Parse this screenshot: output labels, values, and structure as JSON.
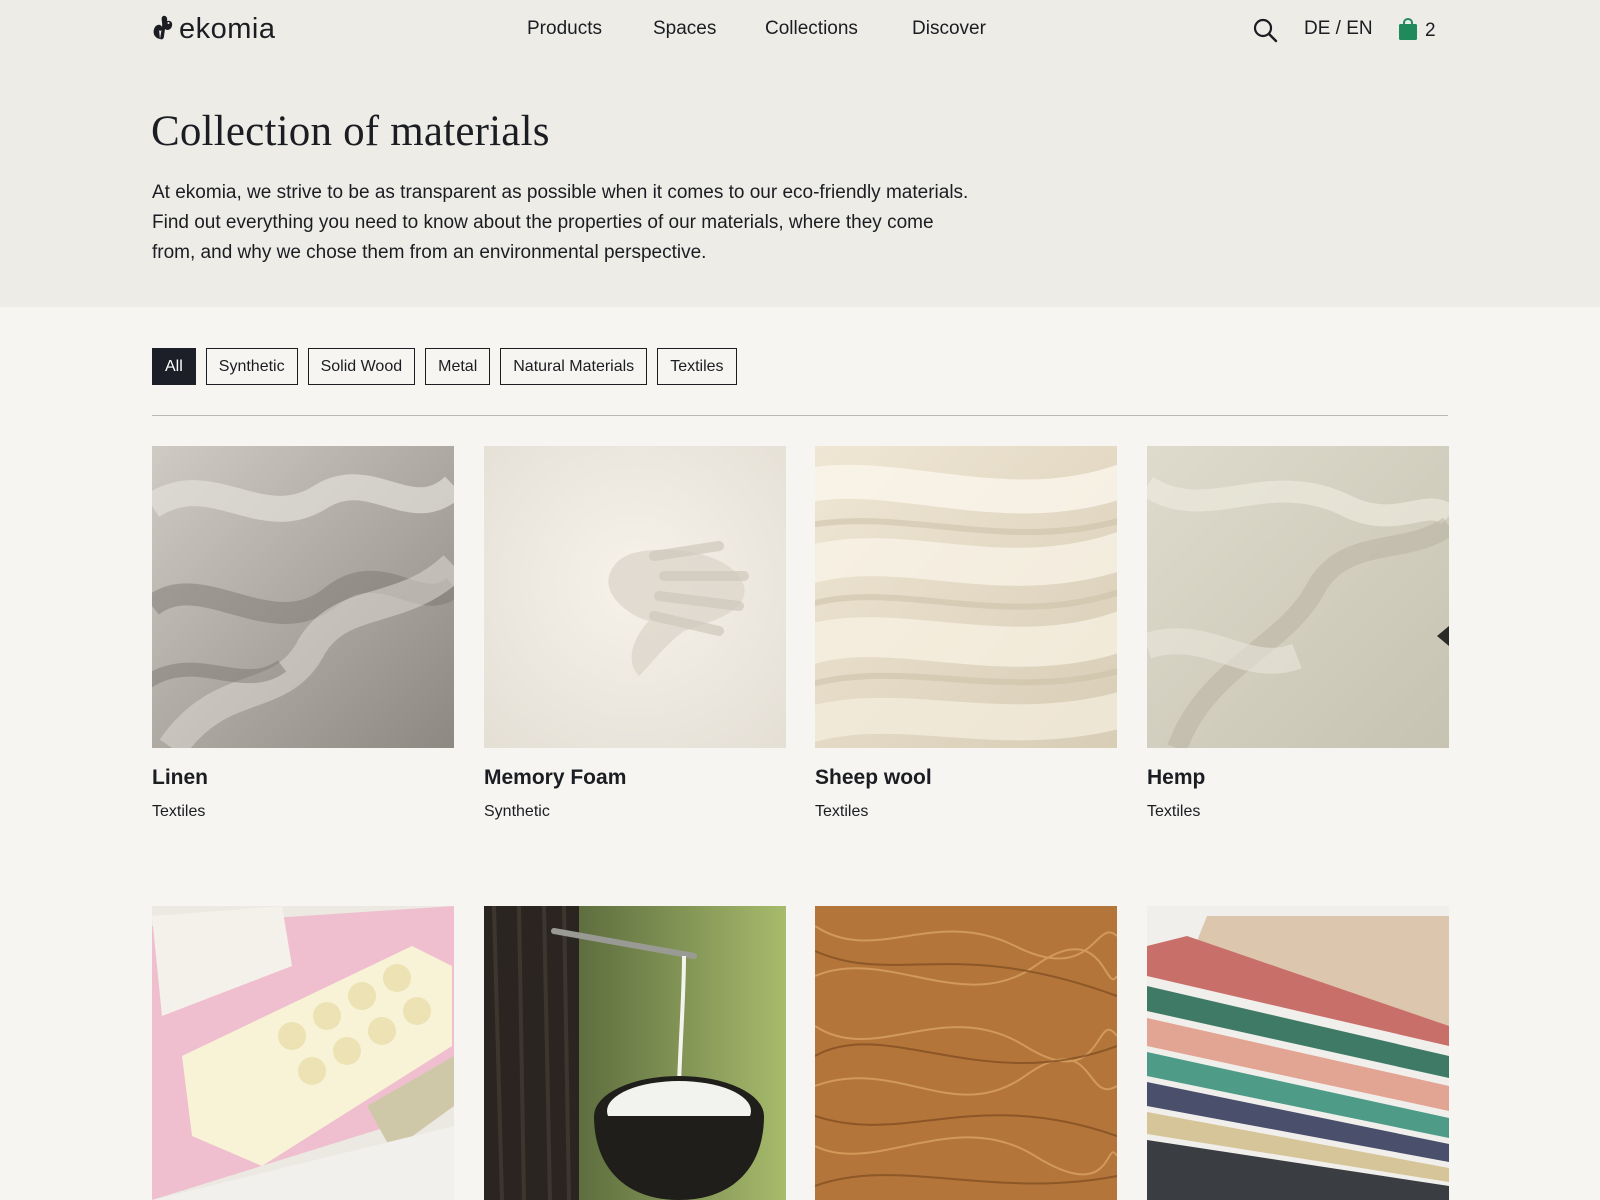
{
  "brand": {
    "name": "ekomia"
  },
  "nav": {
    "items": [
      {
        "label": "Products"
      },
      {
        "label": "Spaces"
      },
      {
        "label": "Collections"
      },
      {
        "label": "Discover"
      }
    ],
    "lang": "DE / EN",
    "cart_count": "2",
    "icons": [
      "search-icon",
      "shopping-bag-icon"
    ]
  },
  "hero": {
    "title": "Collection of materials",
    "intro_lines": [
      "At ekomia, we strive to be as transparent as possible when it comes to our eco-friendly materials.",
      "Find out everything you need to know about the properties of our materials, where they come",
      "from, and why we chose them from an environmental perspective."
    ]
  },
  "filters": {
    "active": "All",
    "chips": [
      {
        "label": "All"
      },
      {
        "label": "Synthetic"
      },
      {
        "label": "Solid Wood"
      },
      {
        "label": "Metal"
      },
      {
        "label": "Natural Materials"
      },
      {
        "label": "Textiles"
      }
    ]
  },
  "materials": [
    {
      "name": "Linen",
      "category": "Textiles"
    },
    {
      "name": "Memory Foam",
      "category": "Synthetic"
    },
    {
      "name": "Sheep wool",
      "category": "Textiles"
    },
    {
      "name": "Hemp",
      "category": "Textiles"
    }
  ],
  "colors": {
    "hero_bg": "#edece7",
    "page_bg": "#f6f5f1",
    "text": "#1b1d22",
    "active_chip": "#1c1f27",
    "cart_accent": "#1f8a5b"
  }
}
